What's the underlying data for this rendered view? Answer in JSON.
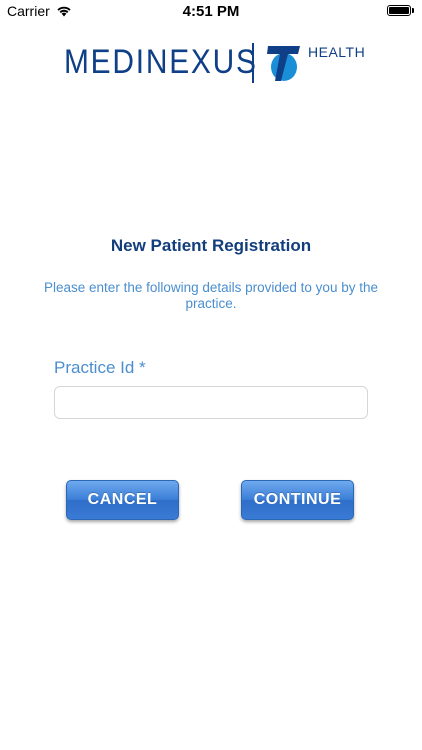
{
  "status_bar": {
    "carrier": "Carrier",
    "time": "4:51 PM",
    "wifi_icon": "wifi-icon",
    "battery_icon": "battery-icon"
  },
  "header": {
    "brand_name": "MEDINEXUS",
    "partner_label": "HEALTH",
    "partner_logo_icon": "telstra-t-logo-icon",
    "brand_color": "#0f3f86",
    "partner_color": "#1a8fd8"
  },
  "form": {
    "title": "New Patient Registration",
    "instructions": "Please enter the following details provided to you by the practice.",
    "practice_id_label": "Practice Id *",
    "practice_id_value": "",
    "practice_id_placeholder": "",
    "title_color": "#123e7c",
    "text_color": "#4a8ecf"
  },
  "actions": {
    "cancel_label": "CANCEL",
    "continue_label": "CONTINUE",
    "button_color": "#3c7fd8"
  }
}
